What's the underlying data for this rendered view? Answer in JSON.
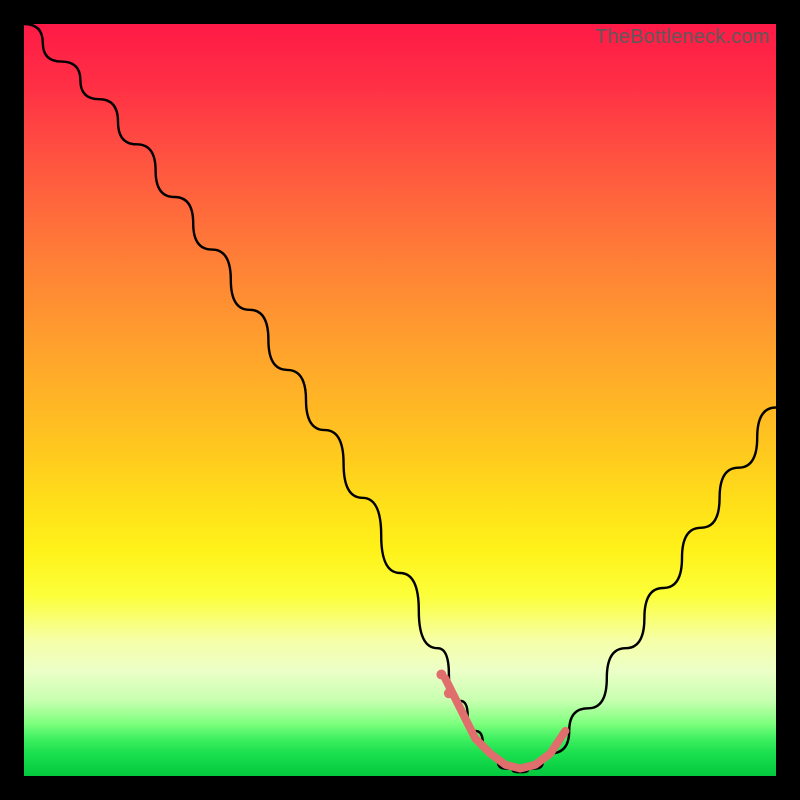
{
  "watermark": "TheBottleneck.com",
  "chart_data": {
    "type": "line",
    "title": "",
    "xlabel": "",
    "ylabel": "",
    "xlim": [
      0,
      100
    ],
    "ylim": [
      0,
      100
    ],
    "grid": false,
    "legend": false,
    "series": [
      {
        "name": "bottleneck-curve",
        "x": [
          0,
          5,
          10,
          15,
          20,
          25,
          30,
          35,
          40,
          45,
          50,
          55,
          58,
          60,
          62,
          64,
          66,
          68,
          70,
          75,
          80,
          85,
          90,
          95,
          100
        ],
        "y": [
          100,
          95,
          90,
          84,
          77,
          70,
          62,
          54,
          46,
          37,
          27,
          17,
          10,
          6,
          3,
          1,
          0.5,
          1,
          3,
          9,
          17,
          25,
          33,
          41,
          49
        ]
      }
    ],
    "highlight": {
      "name": "optimal-range-band",
      "x": [
        56,
        58,
        60,
        62,
        64,
        66,
        68,
        70,
        72
      ],
      "y": [
        13,
        9,
        5,
        3,
        1.5,
        1,
        1.5,
        3,
        6
      ]
    },
    "highlight_dots": {
      "x": [
        55.5,
        56.5
      ],
      "y": [
        13.5,
        11
      ]
    },
    "background_gradient": {
      "top": "#ff1a47",
      "mid_upper": "#ff8136",
      "mid": "#ffe019",
      "mid_lower": "#f6ffa8",
      "bottom": "#04c83e"
    }
  }
}
